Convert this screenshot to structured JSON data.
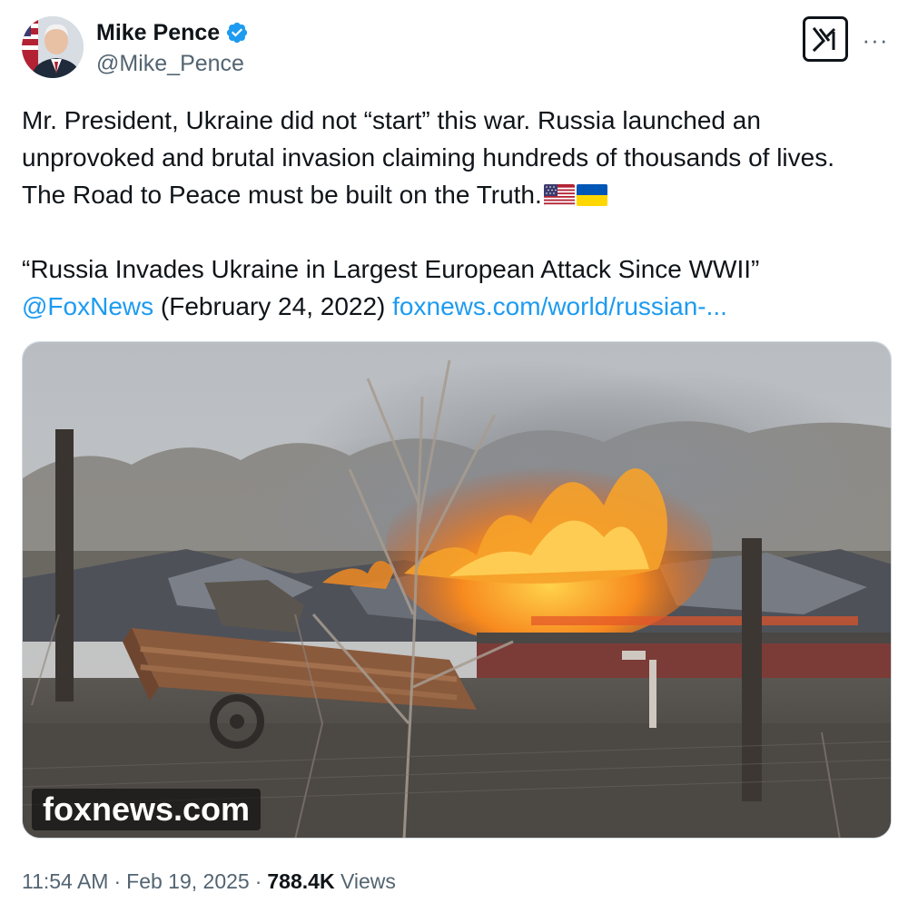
{
  "author": {
    "name": "Mike Pence",
    "handle": "@Mike_Pence",
    "verified": true,
    "verified_color": "#1d9bf0"
  },
  "header_actions": {
    "grok_icon": "xai-grok-icon",
    "more_icon": "more-dots-icon",
    "more_label": "···"
  },
  "tweet": {
    "line1": "Mr. President, Ukraine did not “start” this war. Russia launched an",
    "line2": "unprovoked and brutal invasion claiming hundreds of thousands of lives.",
    "line3": "The Road to Peace must be built on the Truth.",
    "emoji": [
      "flag-us",
      "flag-ukraine"
    ],
    "quote_headline": "“Russia Invades Ukraine in Largest European Attack Since WWII”",
    "mention": "@FoxNews",
    "date_text": " (February 24, 2022) ",
    "link_text": "foxnews.com/world/russian-..."
  },
  "media": {
    "description_icon": "burning-building-photo",
    "watermark": "foxnews.com"
  },
  "meta": {
    "time": "11:54 AM",
    "separator": "·",
    "date": "Feb 19, 2025",
    "views_count": "788.4K",
    "views_label": "Views"
  },
  "colors": {
    "text": "#0f1419",
    "secondary": "#536471",
    "link": "#1d9bf0",
    "border": "#cfd9de"
  }
}
